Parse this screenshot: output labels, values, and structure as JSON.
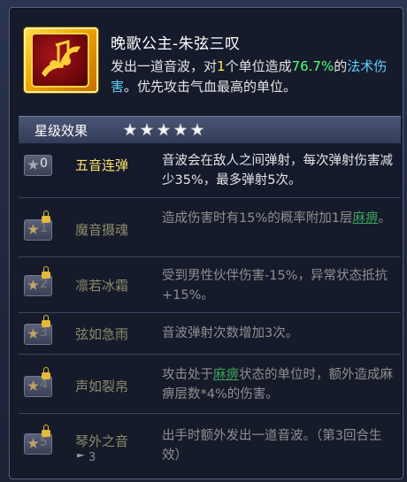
{
  "skill": {
    "name": "晚歌公主-朱弦三叹",
    "desc_part1": "发出一道音波，对",
    "target_count": "1",
    "desc_part2": "个单位造成",
    "percent": "76.7%",
    "desc_part3": "的",
    "damage_type": "法术伤害",
    "desc_part4": "。优先攻击气血最高的单位。",
    "icon": "music-note-icon"
  },
  "star_bar": {
    "label": "星级效果",
    "stars": 5
  },
  "rows": [
    {
      "level": "0",
      "name": "五音连弹",
      "locked": false,
      "desc": "音波会在敌人之间弹射，每次弹射伤害减少35%，最多弹射5次。"
    },
    {
      "level": "1",
      "name": "魔音摄魂",
      "locked": true,
      "desc_a": "造成伤害时有15%的概率附加1层",
      "desc_link": "麻痹",
      "desc_b": "。"
    },
    {
      "level": "2",
      "name": "凛若冰霜",
      "locked": true,
      "desc": "受到男性伙伴伤害-15%，异常状态抵抗+15%。"
    },
    {
      "level": "3",
      "name": "弦如急雨",
      "locked": true,
      "desc": "音波弹射次数增加3次。"
    },
    {
      "level": "4",
      "name": "声如裂帛",
      "locked": true,
      "desc_a": "攻击处于",
      "desc_link": "麻痹",
      "desc_b": "状态的单位时，额外造成麻痹层数*4%的伤害。"
    },
    {
      "level": "5",
      "name": "琴外之音",
      "locked": true,
      "sub": "3",
      "desc": "出手时额外发出一道音波。（第3回合生效）"
    }
  ]
}
